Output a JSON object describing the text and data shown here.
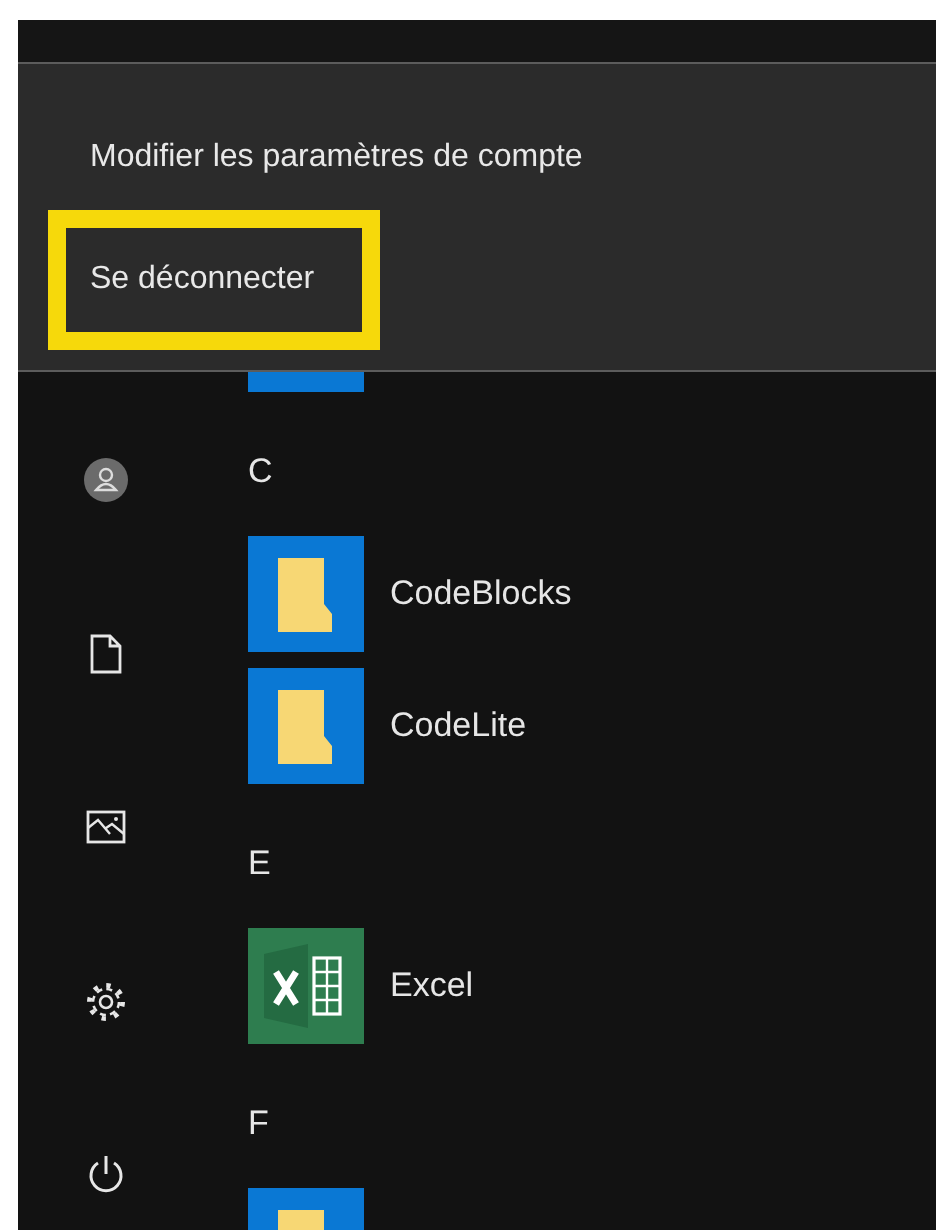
{
  "account_menu": {
    "items": [
      {
        "label": "Modifier les paramètres de compte",
        "highlighted": false
      },
      {
        "label": "Se déconnecter",
        "highlighted": true
      }
    ]
  },
  "sidebar": {
    "items": [
      {
        "kind": "user"
      },
      {
        "kind": "documents"
      },
      {
        "kind": "pictures"
      },
      {
        "kind": "settings"
      },
      {
        "kind": "power"
      }
    ]
  },
  "app_list": [
    {
      "kind": "partial"
    },
    {
      "kind": "letter",
      "label": "C"
    },
    {
      "kind": "folder",
      "label": "CodeBlocks"
    },
    {
      "kind": "folder",
      "label": "CodeLite"
    },
    {
      "kind": "letter",
      "label": "E"
    },
    {
      "kind": "excel",
      "label": "Excel"
    },
    {
      "kind": "letter",
      "label": "F"
    },
    {
      "kind": "partial"
    }
  ]
}
